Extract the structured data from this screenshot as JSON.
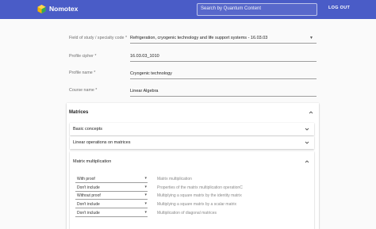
{
  "app": {
    "name": "Nomotex",
    "logo_color": "#f4b400"
  },
  "search": {
    "placeholder": "Search by Quantum Content"
  },
  "header": {
    "logout_label": "LOG OUT"
  },
  "form": {
    "field_of_study": {
      "label": "Field of study / specialty code *",
      "value": "Refrigeration, cryogenic technology and life support systems - 16.03.03"
    },
    "profile_cipher": {
      "label": "Profile cipher *",
      "value": "16.03.03_1010"
    },
    "profile_name": {
      "label": "Profile name *",
      "value": "Cryogenic technology"
    },
    "course_name": {
      "label": "Course name *",
      "value": "Linear Algebra"
    }
  },
  "section": {
    "title": "Matrices",
    "subsections": [
      {
        "title": "Basic concepts"
      },
      {
        "title": "Linear operations on matrices"
      },
      {
        "title": "Matrix multiplication"
      }
    ]
  },
  "matrix_multiplication": {
    "items": [
      {
        "option": "With proof",
        "description": "Matrix multiplication"
      },
      {
        "option": "Don't include",
        "description": "Properties of the matrix multiplication operationC"
      },
      {
        "option": "Without proof",
        "description": "Multiplying a square matrix by the identity matrix"
      },
      {
        "option": "Don't include",
        "description": "Multiplying a square matrix by a scalar matrix"
      },
      {
        "option": "Don't include",
        "description": "Multiplication of diagonal matrices"
      }
    ]
  },
  "colors": {
    "appbar": "#4a5cc7",
    "background": "#fafafa"
  }
}
